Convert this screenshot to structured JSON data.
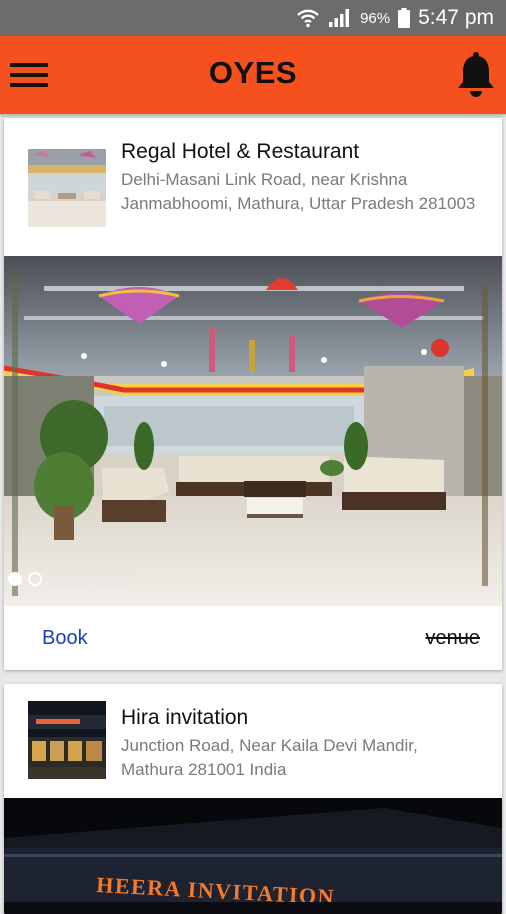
{
  "status_bar": {
    "battery": "96%",
    "time": "5:47 pm"
  },
  "app_bar": {
    "title": "OYES"
  },
  "listings": [
    {
      "name": "Regal Hotel & Restaurant",
      "address": "Delhi-Masani Link Road, near Krishna Janmabhoomi, Mathura, Uttar Pradesh 281003",
      "photo_watermark": [
        "REDMI NOTE 5 PRO",
        "MI DUAL CAMERA"
      ],
      "actions": {
        "book_label": "Book",
        "venue_label": "venue"
      }
    },
    {
      "name": "Hira invitation",
      "address": "Junction Road, Near Kaila Devi Mandir, Mathura 281001 India",
      "sign_text": "HEERA INVITATION"
    }
  ],
  "colors": {
    "app_bar": "#f4511e",
    "status_bar": "#6c6c6c",
    "book_link": "#1a3fb8"
  }
}
